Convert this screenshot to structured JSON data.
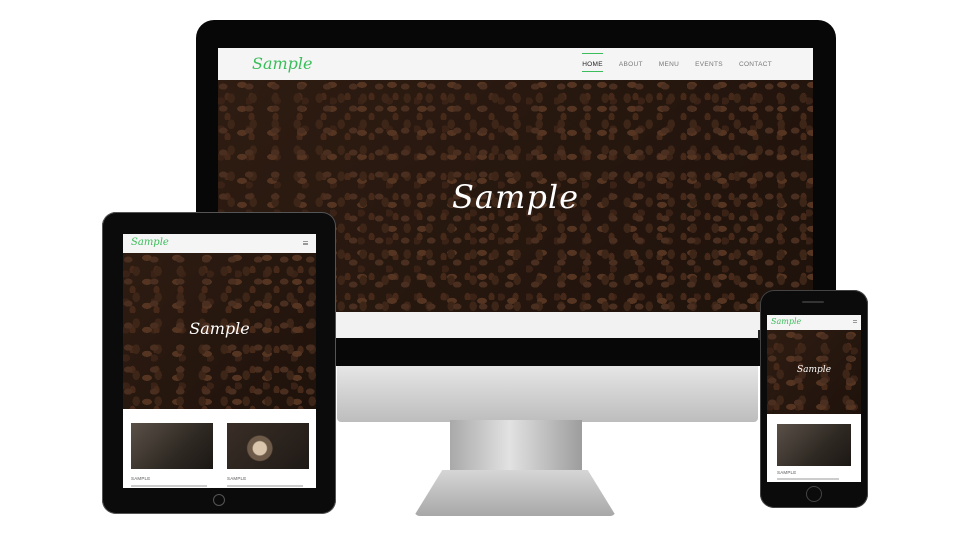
{
  "brand": {
    "logo_text": "Sample",
    "accent_color": "#3bbd5b"
  },
  "desktop": {
    "nav": [
      {
        "label": "HOME",
        "active": true
      },
      {
        "label": "ABOUT",
        "active": false
      },
      {
        "label": "MENU",
        "active": false
      },
      {
        "label": "EVENTS",
        "active": false
      },
      {
        "label": "CONTACT",
        "active": false
      }
    ],
    "hero_title": "Sample"
  },
  "tablet": {
    "hero_title": "Sample",
    "cards": [
      {
        "label": "SAMPLE"
      },
      {
        "label": "SAMPLE"
      }
    ]
  },
  "phone": {
    "hero_title": "Sample",
    "cards": [
      {
        "label": "SAMPLE"
      }
    ]
  },
  "icons": [
    "hamburger-menu-icon",
    "home-button-icon"
  ]
}
